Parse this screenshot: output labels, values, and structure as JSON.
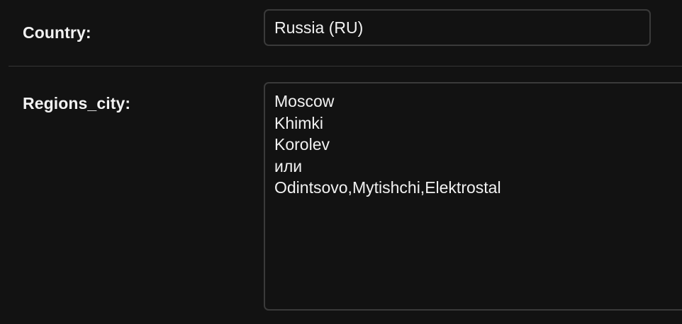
{
  "country": {
    "label": "Country:",
    "value": "Russia (RU)"
  },
  "regions_city": {
    "label": "Regions_city:",
    "value": "Moscow\nKhimki\nKorolev\nили\nOdintsovo,Mytishchi,Elektrostal"
  }
}
